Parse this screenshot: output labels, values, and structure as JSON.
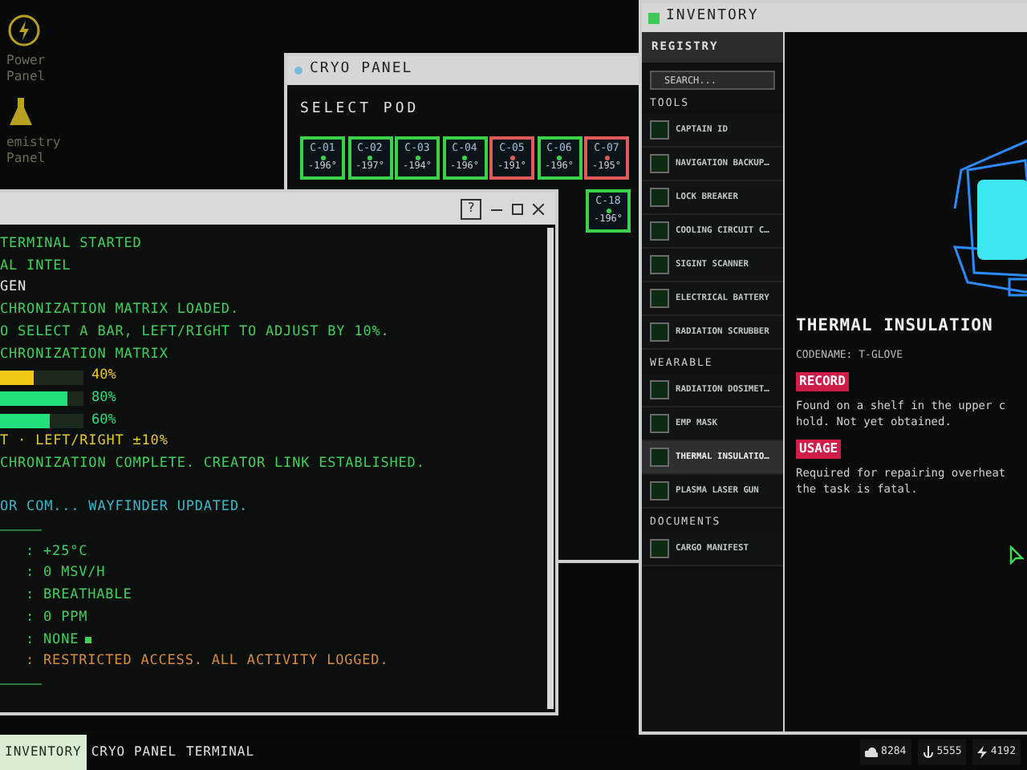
{
  "desktop_icons": [
    {
      "kind": "power",
      "label": "Power Panel"
    },
    {
      "kind": "flask",
      "label": "emistry Panel"
    }
  ],
  "cryo_window": {
    "title": "CRYO PANEL",
    "heading": "SELECT POD",
    "pods": [
      {
        "label": "C-01",
        "temp": "-196°",
        "color": "#3ad24a"
      },
      {
        "label": "C-02",
        "temp": "-197°",
        "color": "#3ad24a"
      },
      {
        "label": "C-03",
        "temp": "-194°",
        "color": "#3ad24a"
      },
      {
        "label": "C-04",
        "temp": "-196°",
        "color": "#3ad24a"
      },
      {
        "label": "C-05",
        "temp": "-191°",
        "color": "#e05a5a"
      },
      {
        "label": "C-06",
        "temp": "-196°",
        "color": "#3ad24a"
      },
      {
        "label": "C-07",
        "temp": "-195°",
        "color": "#e05a5a"
      }
    ],
    "pods_row_2": [
      {
        "label": "C-18",
        "temp": "-196°",
        "color": "#3ad24a"
      }
    ]
  },
  "terminal_window": {
    "help": "?",
    "lines": [
      {
        "kind": "text",
        "color": "#3fcf5a",
        "text": "TERMINAL STARTED"
      },
      {
        "kind": "text",
        "color": "#3fcf5a",
        "text": "AL INTEL"
      },
      {
        "kind": "text",
        "color": "#e8e8e8",
        "text": "GEN"
      },
      {
        "kind": "text",
        "color": "#3fcf5a",
        "text": "CHRONIZATION MATRIX LOADED."
      },
      {
        "kind": "text",
        "color": "#3fcf5a",
        "text": "O SELECT A BAR, LEFT/RIGHT TO ADJUST BY 10%."
      },
      {
        "kind": "text",
        "color": "#3fcf5a",
        "text": "CHRONIZATION MATRIX"
      },
      {
        "kind": "bar",
        "color": "#f0c818",
        "level": 0.4,
        "reading": "40%"
      },
      {
        "kind": "bar",
        "color": "#22e07a",
        "level": 0.8,
        "reading": "80%"
      },
      {
        "kind": "bar",
        "color": "#22e07a",
        "level": 0.6,
        "reading": "60%"
      },
      {
        "kind": "text",
        "color": "#e6c62a",
        "text": "T · LEFT/RIGHT ±10%"
      },
      {
        "kind": "text",
        "color": "#3fcf5a",
        "text": "CHRONIZATION COMPLETE. CREATOR LINK ESTABLISHED."
      },
      {
        "kind": "blank"
      },
      {
        "kind": "text",
        "color": "#3ab6c8",
        "text": "OR COM... WAYFINDER UPDATED."
      },
      {
        "kind": "rule"
      },
      {
        "kind": "value",
        "color": "#3fcf5a",
        "text": ": +25°C",
        "square": false
      },
      {
        "kind": "value",
        "color": "#3fcf5a",
        "text": ": 0 MSV/H",
        "square": false
      },
      {
        "kind": "value",
        "color": "#3fcf5a",
        "text": ": BREATHABLE",
        "square": false
      },
      {
        "kind": "value",
        "color": "#3fcf5a",
        "text": ": 0 PPM",
        "square": false
      },
      {
        "kind": "value",
        "color": "#3fcf5a",
        "text": ": NONE",
        "square": true
      },
      {
        "kind": "value",
        "color": "#d98b3a",
        "text": ": RESTRICTED ACCESS. ALL ACTIVITY LOGGED.",
        "square": false
      },
      {
        "kind": "rule"
      }
    ]
  },
  "inventory_window": {
    "title": "INVENTORY",
    "registry": "REGISTRY",
    "search": {
      "placeholder": "SEARCH..."
    },
    "sections": [
      {
        "title": "TOOLS",
        "items": [
          {
            "label": "CAPTAIN ID",
            "selected": false
          },
          {
            "label": "NAVIGATION BACKUP…",
            "selected": false
          },
          {
            "label": "LOCK BREAKER",
            "selected": false
          },
          {
            "label": "COOLING CIRCUIT C…",
            "selected": false
          },
          {
            "label": "SIGINT SCANNER",
            "selected": false
          },
          {
            "label": "ELECTRICAL BATTERY",
            "selected": false
          },
          {
            "label": "RADIATION SCRUBBER",
            "selected": false
          }
        ]
      },
      {
        "title": "WEARABLE",
        "items": [
          {
            "label": "RADIATION DOSIMET…",
            "selected": false
          },
          {
            "label": "EMP MASK",
            "selected": false
          },
          {
            "label": "THERMAL INSULATIO…",
            "selected": true
          },
          {
            "label": "PLASMA LASER GUN",
            "selected": false
          }
        ]
      },
      {
        "title": "DOCUMENTS",
        "items": [
          {
            "label": "CARGO MANIFEST",
            "selected": false
          }
        ]
      }
    ],
    "detail": {
      "name": "THERMAL INSULATION",
      "codename": "CODENAME: T-GLOVE",
      "blocks": [
        {
          "tag": "RECORD",
          "lines": [
            "Found on a shelf in the upper c",
            "hold. Not yet obtained."
          ]
        },
        {
          "tag": "USAGE",
          "lines": [
            "Required for repairing overheat",
            "the task is fatal."
          ]
        }
      ]
    }
  },
  "taskbar": {
    "tabs": [
      {
        "label": "INVENTORY",
        "selected": true
      },
      {
        "label": "CRYO PANEL",
        "selected": false
      },
      {
        "label": "TERMINAL",
        "selected": false
      }
    ],
    "stats": [
      {
        "kind": "cloud",
        "value": "8284"
      },
      {
        "kind": "anchor",
        "value": "5555"
      },
      {
        "kind": "bolt",
        "value": "4192"
      }
    ]
  }
}
